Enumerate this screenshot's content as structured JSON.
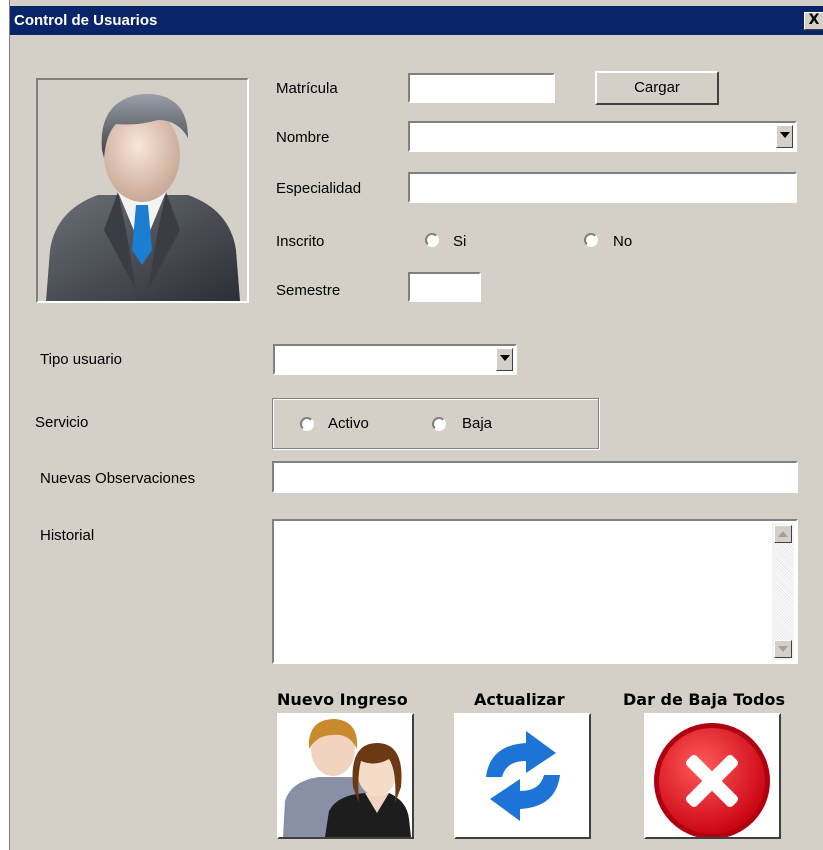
{
  "window": {
    "title": "Control de Usuarios",
    "close_glyph": "X"
  },
  "form": {
    "matricula_label": "Matrícula",
    "matricula_value": "",
    "cargar_label": "Cargar",
    "nombre_label": "Nombre",
    "nombre_value": "",
    "especialidad_label": "Especialidad",
    "especialidad_value": "",
    "inscrito_label": "Inscrito",
    "inscrito_options": [
      "Si",
      "No"
    ],
    "semestre_label": "Semestre",
    "semestre_value": "",
    "tipo_usuario_label": "Tipo usuario",
    "tipo_usuario_value": "",
    "servicio_label": "Servicio",
    "servicio_options": [
      "Activo",
      "Baja"
    ],
    "observaciones_label": "Nuevas Observaciones",
    "observaciones_value": "",
    "historial_label": "Historial",
    "historial_value": ""
  },
  "actions": {
    "nuevo_label": "Nuevo Ingreso",
    "actualizar_label": "Actualizar",
    "baja_label": "Dar de Baja Todos"
  },
  "icons": {
    "photo": "user-avatar-icon",
    "nuevo": "users-add-icon",
    "actualizar": "refresh-icon",
    "baja": "delete-all-icon"
  },
  "colors": {
    "titlebar": "#0a246a",
    "window_bg": "#d4d0c8",
    "refresh_blue": "#1e73d6",
    "delete_red": "#e0141e"
  }
}
